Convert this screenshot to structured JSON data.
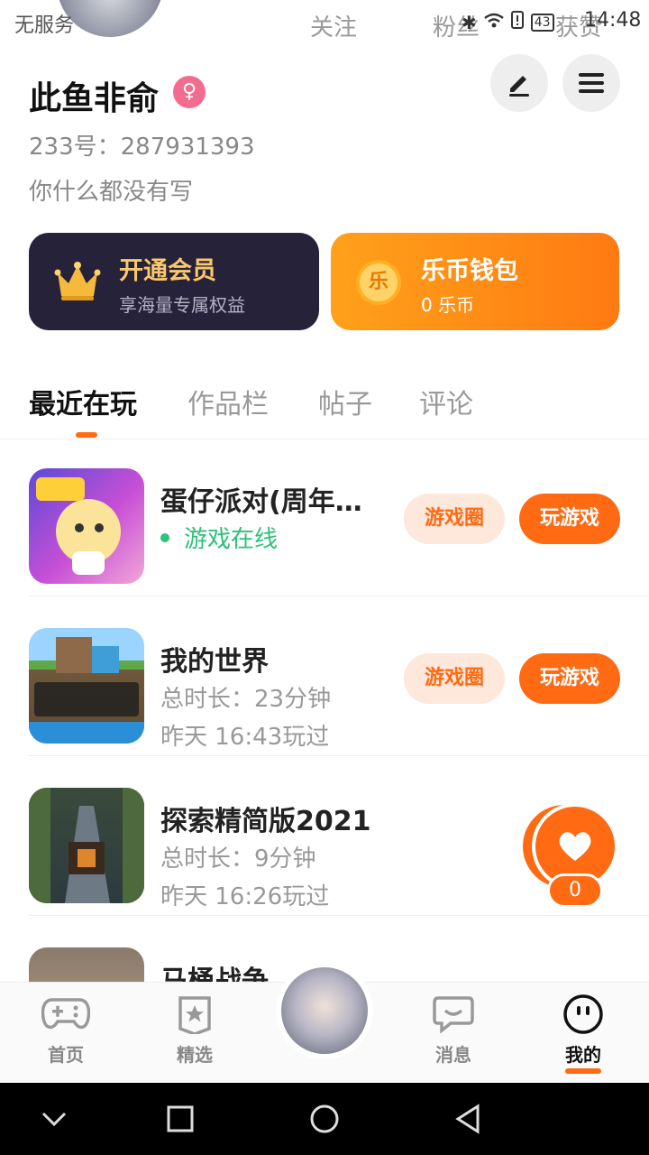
{
  "status_bar": {
    "carrier": "无服务",
    "overlay_tab_follow": "关注",
    "overlay_tab_fans": "粉丝",
    "overlay_tab_likes": "获赞",
    "battery": "43",
    "time": "14:48"
  },
  "profile": {
    "name": "此鱼非俞",
    "gender_symbol": "♀",
    "uid_text": "233号：287931393",
    "bio": "你什么都没有写"
  },
  "cards": {
    "vip_title": "开通会员",
    "vip_sub": "享海量专属权益",
    "wallet_icon_text": "乐",
    "wallet_title": "乐币钱包",
    "wallet_sub": "0 乐币"
  },
  "tabs": [
    {
      "label": "最近在玩",
      "active": true
    },
    {
      "label": "作品栏",
      "active": false
    },
    {
      "label": "帖子",
      "active": false
    },
    {
      "label": "评论",
      "active": false
    }
  ],
  "games": [
    {
      "title": "蛋仔派对(周年…",
      "status": "游戏在线",
      "btn_circle": "游戏圈",
      "btn_play": "玩游戏"
    },
    {
      "title": "我的世界",
      "duration": "总时长：23分钟",
      "last_played": "昨天 16:43玩过",
      "btn_circle": "游戏圈",
      "btn_play": "玩游戏"
    },
    {
      "title": "探索精简版2021",
      "duration": "总时长：9分钟",
      "last_played": "昨天 16:26玩过"
    },
    {
      "title": "马桶战争"
    }
  ],
  "like_count": "0",
  "bottom_nav": {
    "home": "首页",
    "featured": "精选",
    "messages": "消息",
    "mine": "我的"
  },
  "icons": [
    "gamepad-icon",
    "star-icon",
    "chat-icon",
    "face-icon",
    "pencil-icon",
    "menu-icon",
    "crown-icon",
    "heart-icon"
  ],
  "colors": {
    "accent": "#ff6a13",
    "online": "#2fc07a",
    "vip_bg": "#26223a"
  }
}
